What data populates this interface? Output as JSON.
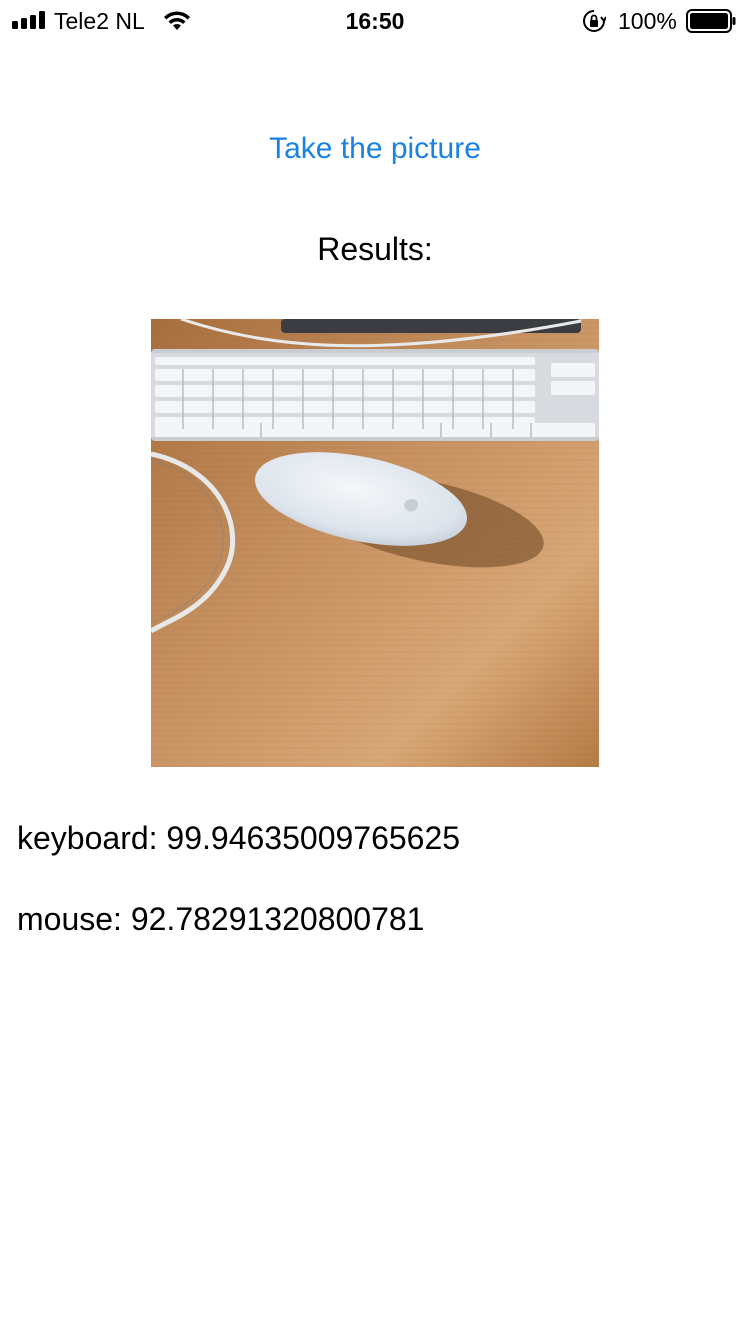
{
  "status_bar": {
    "carrier": "Tele2 NL",
    "time": "16:50",
    "battery_percent": "100%",
    "signal_bars": 4,
    "battery_level": 1.0
  },
  "main": {
    "take_picture_label": "Take the picture",
    "results_heading": "Results:",
    "photo_icon": "photo-keyboard-mouse",
    "results": [
      {
        "label": "keyboard",
        "score": "99.94635009765625",
        "text": "keyboard: 99.94635009765625"
      },
      {
        "label": "mouse",
        "score": "92.78291320800781",
        "text": "mouse: 92.78291320800781"
      }
    ]
  },
  "colors": {
    "link": "#1a82e2",
    "text": "#000000",
    "background": "#ffffff"
  }
}
